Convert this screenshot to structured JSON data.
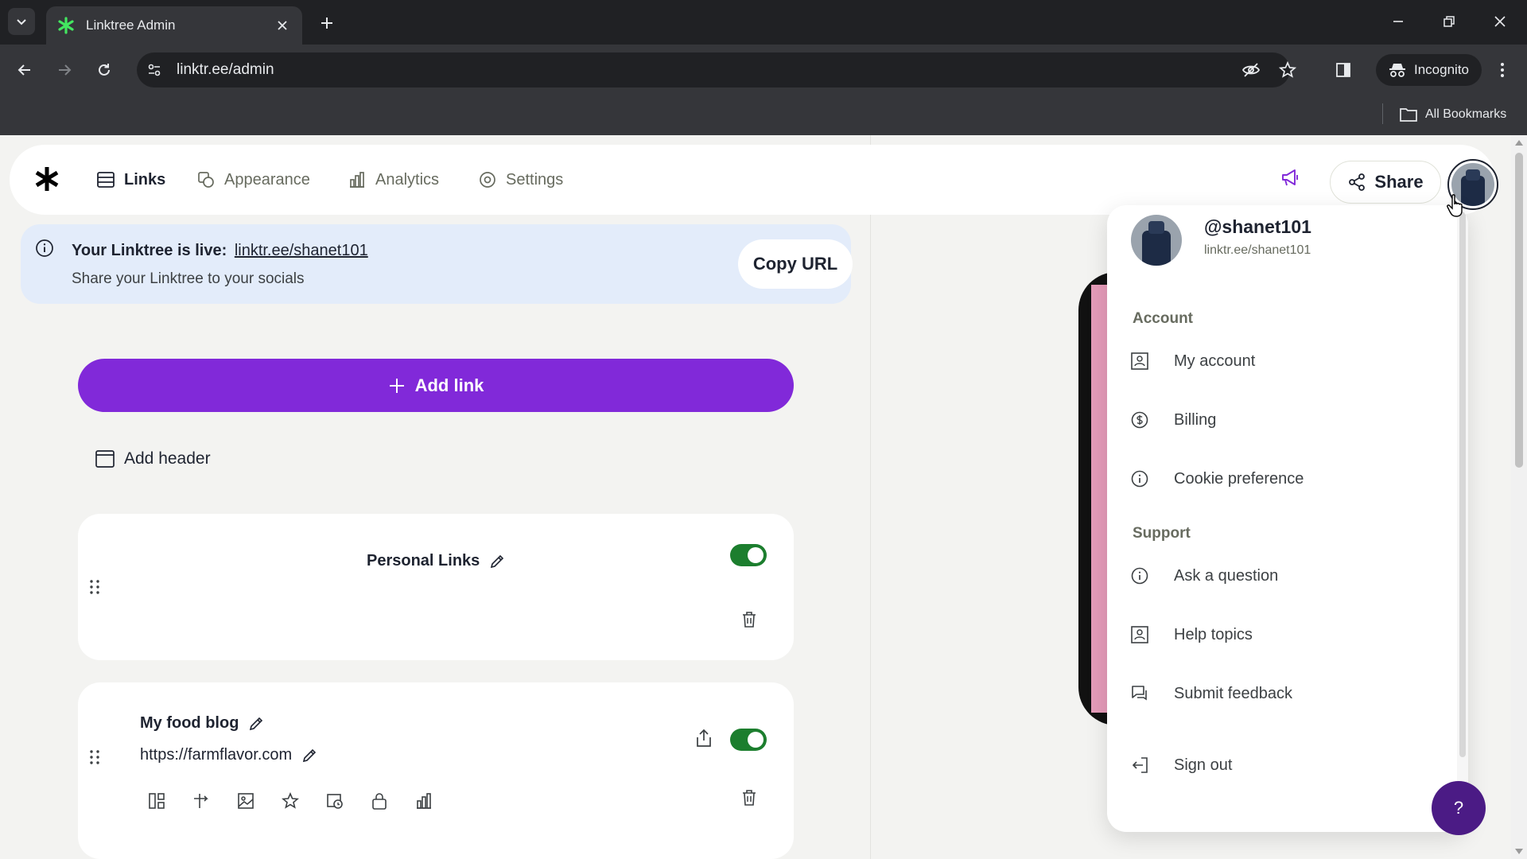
{
  "browser": {
    "tab_title": "Linktree Admin",
    "url": "linktr.ee/admin",
    "incognito_label": "Incognito",
    "bookmarks_label": "All Bookmarks"
  },
  "nav": {
    "links": "Links",
    "appearance": "Appearance",
    "analytics": "Analytics",
    "settings": "Settings",
    "share": "Share"
  },
  "banner": {
    "live_prefix": "Your Linktree is live:",
    "live_url": "linktr.ee/shanet101",
    "subtitle": "Share your Linktree to your socials",
    "copy_button": "Copy URL"
  },
  "add_link": "Add link",
  "add_header": "Add header",
  "cards": [
    {
      "title": "Personal Links",
      "enabled": true
    },
    {
      "title": "My food blog",
      "url": "https://farmflavor.com",
      "enabled": true
    }
  ],
  "menu": {
    "handle": "@shanet101",
    "profile_url": "linktr.ee/shanet101",
    "account_heading": "Account",
    "my_account": "My account",
    "billing": "Billing",
    "cookie_preference": "Cookie preference",
    "support_heading": "Support",
    "ask_question": "Ask a question",
    "help_topics": "Help topics",
    "submit_feedback": "Submit feedback",
    "sign_out": "Sign out"
  },
  "help_fab": "?",
  "colors": {
    "accent_purple": "#8129d9",
    "toggle_green": "#1c7e2e",
    "banner_blue": "#e3ecfa",
    "fab_purple": "#4b1b85"
  }
}
